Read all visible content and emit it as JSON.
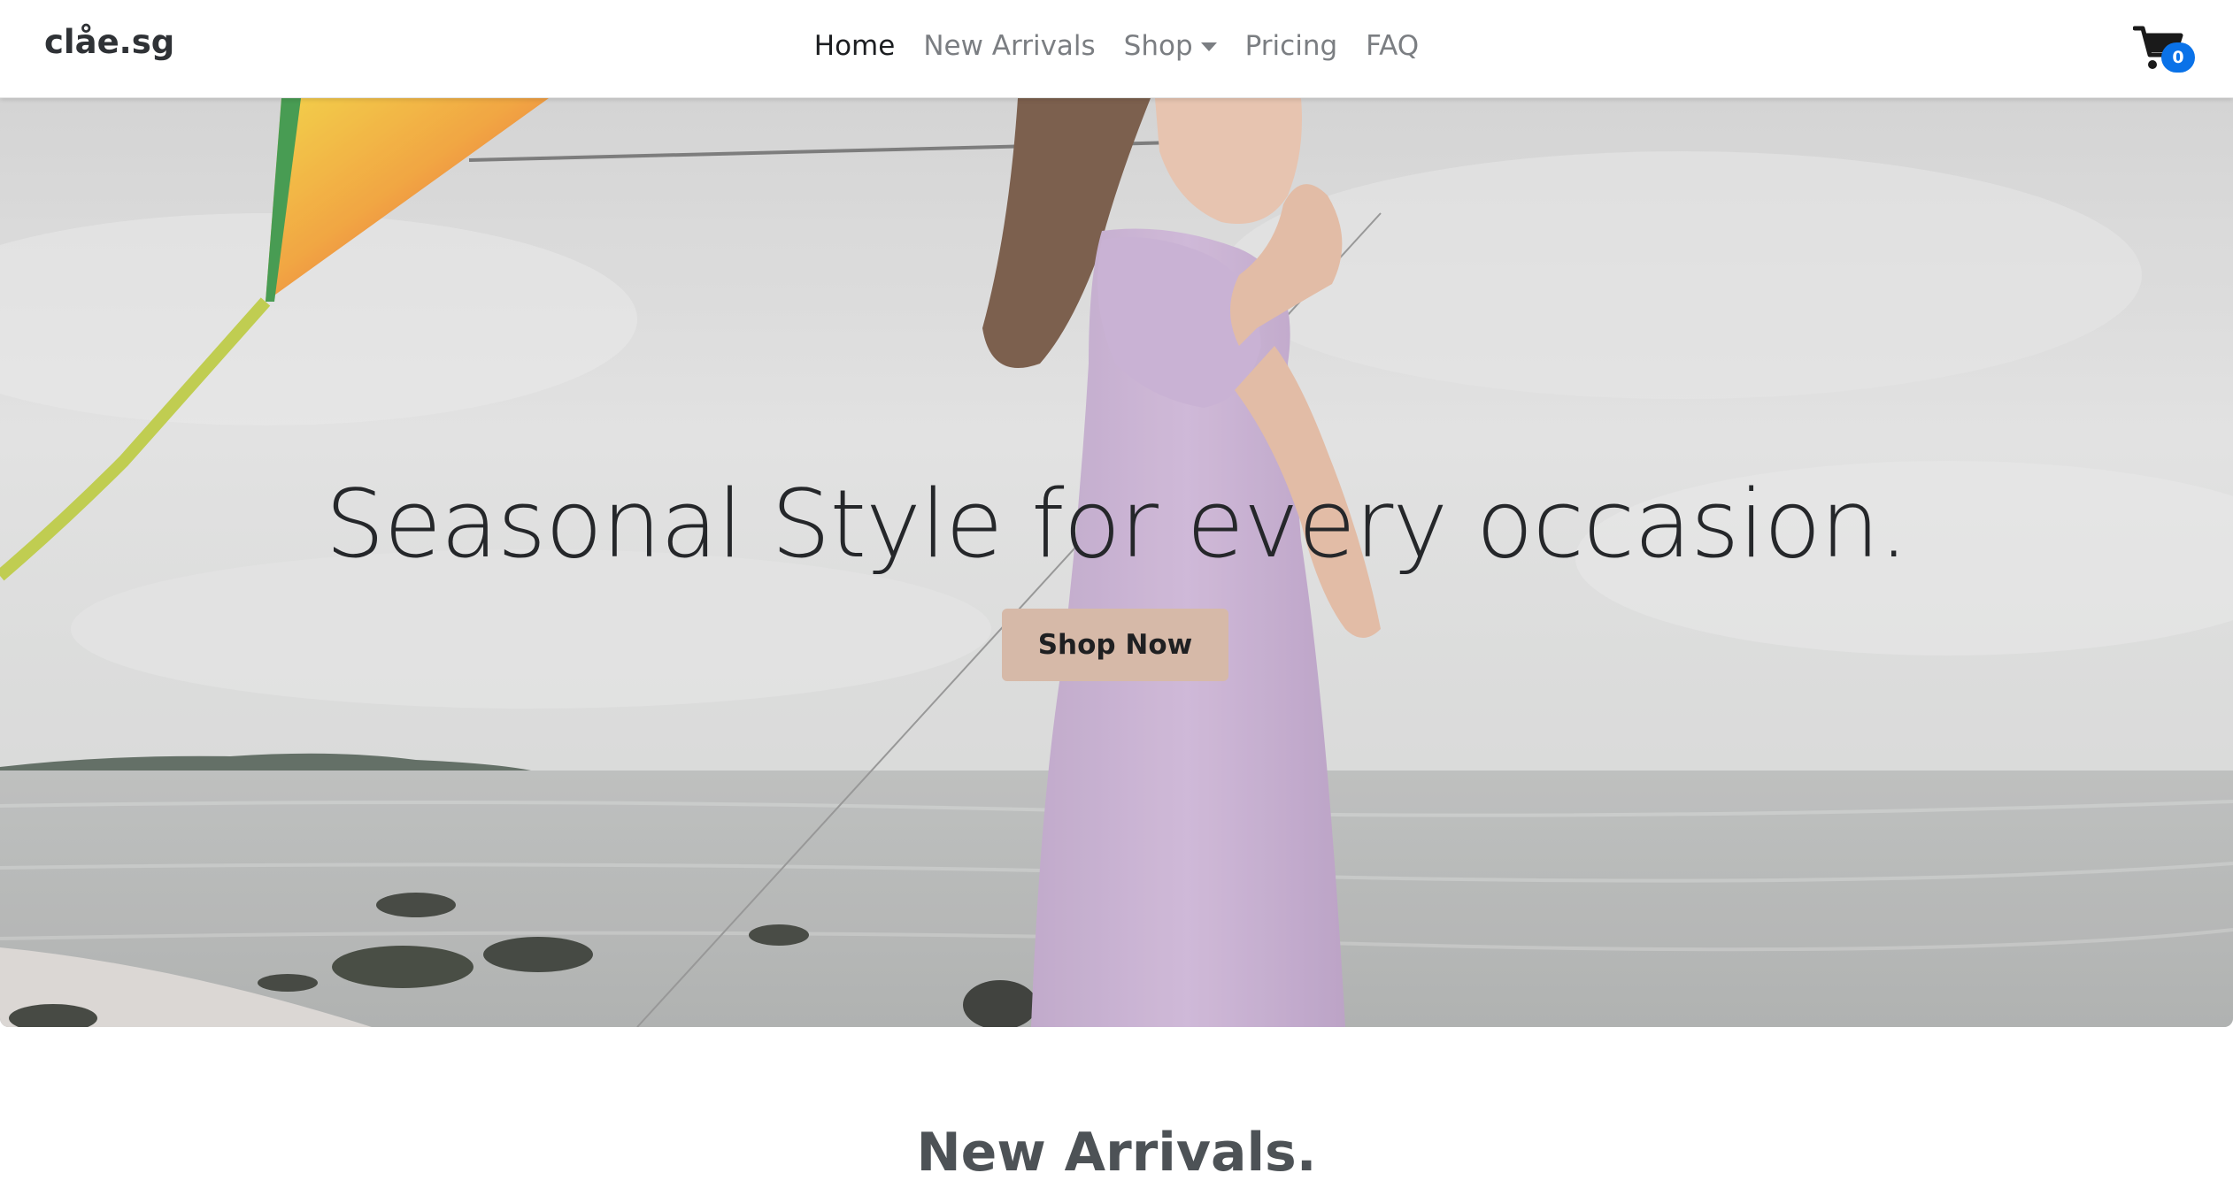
{
  "navbar": {
    "brand": "clåe.sg",
    "links": [
      {
        "label": "Home",
        "active": true
      },
      {
        "label": "New Arrivals",
        "active": false
      },
      {
        "label": "Shop",
        "active": false,
        "dropdown": true
      },
      {
        "label": "Pricing",
        "active": false
      },
      {
        "label": "FAQ",
        "active": false
      }
    ],
    "cart": {
      "icon": "shopping-cart-icon",
      "count": "0",
      "badge_color": "#0a72e8"
    }
  },
  "hero": {
    "title": "Seasonal Style for every occasion.",
    "cta_label": "Shop Now",
    "cta_color": "#d6b9a8",
    "image": "woman-in-lilac-dress-flying-kite-at-beach"
  },
  "new_arrivals": {
    "heading": "New Arrivals."
  }
}
